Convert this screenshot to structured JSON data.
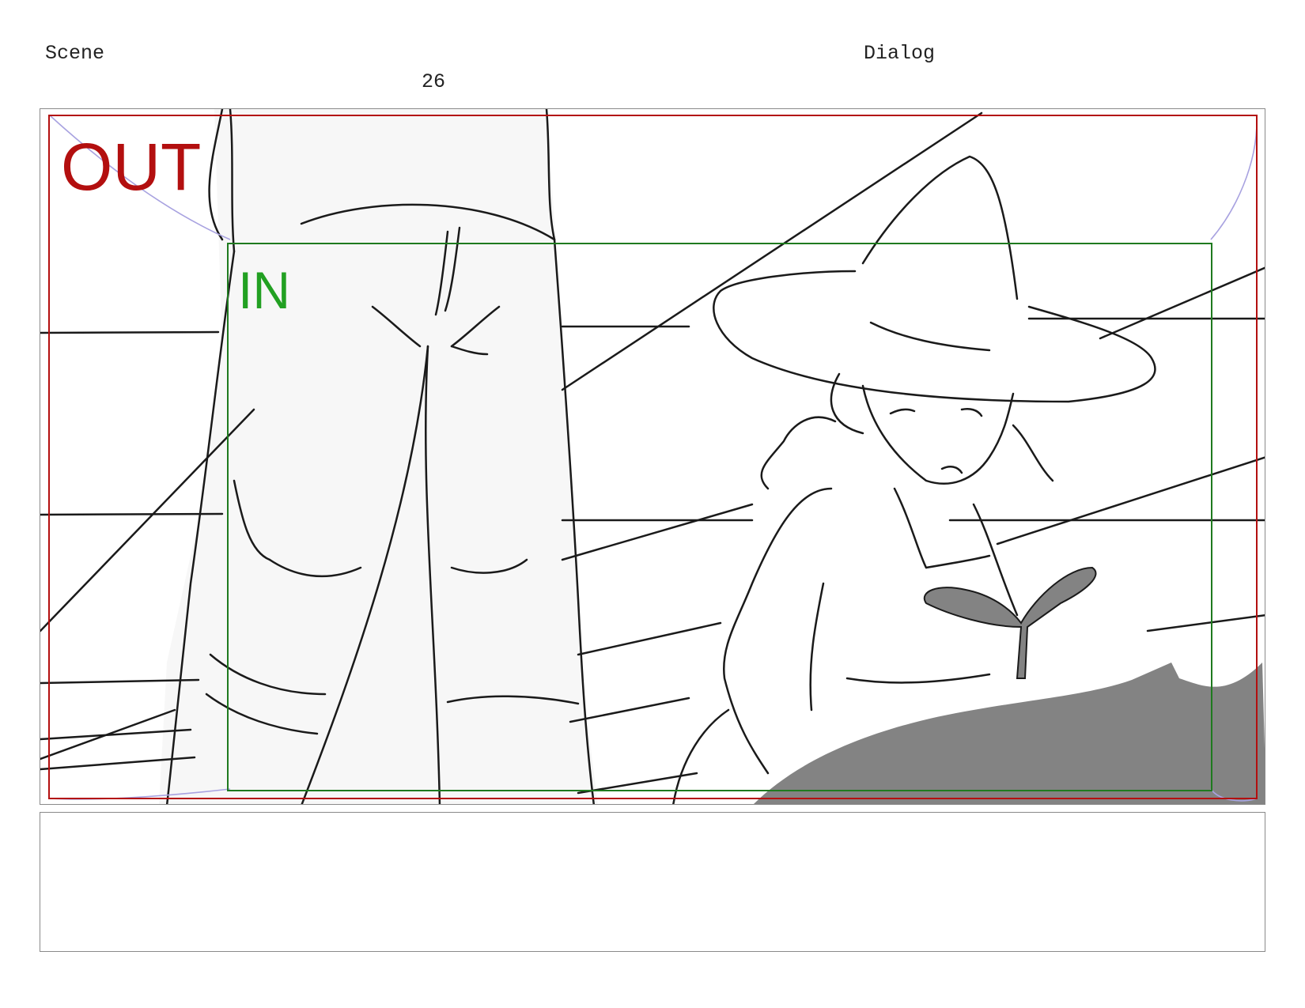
{
  "header": {
    "scene_label": "Scene",
    "scene_number": "26",
    "dialog_label": "Dialog"
  },
  "panel": {
    "out_label": "OUT",
    "in_label": "IN",
    "colors": {
      "out_frame": "#b30f0f",
      "in_frame": "#1f7a1f",
      "in_label": "#22a022",
      "arc_guides": "#a8a2e0",
      "shadow": "#838383",
      "sketch_line": "#1a1a1a",
      "jeans_fill": "#f7f7f7"
    }
  },
  "dialog": {
    "text": ""
  }
}
